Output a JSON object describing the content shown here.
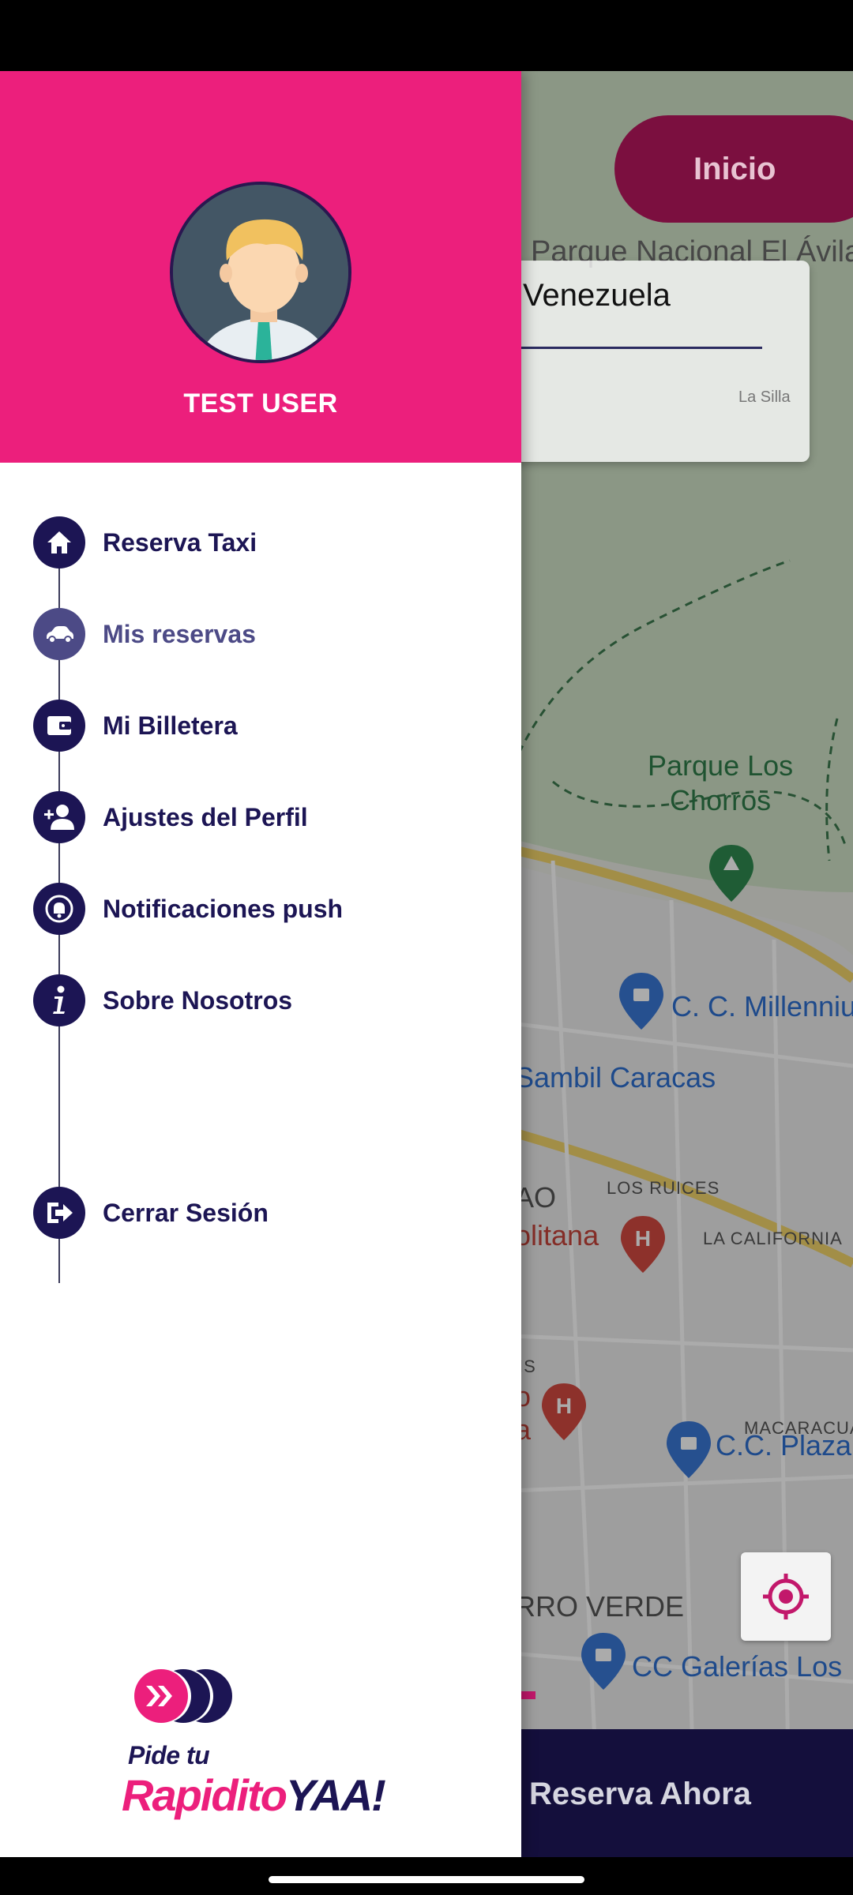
{
  "user": {
    "name": "TEST USER"
  },
  "menu": {
    "items": [
      {
        "label": "Reserva Taxi",
        "icon": "home-icon",
        "active": false
      },
      {
        "label": "Mis reservas",
        "icon": "car-icon",
        "active": true
      },
      {
        "label": "Mi Billetera",
        "icon": "wallet-icon",
        "active": false
      },
      {
        "label": "Ajustes del Perfil",
        "icon": "add-user-icon",
        "active": false
      },
      {
        "label": "Notificaciones push",
        "icon": "bell-icon",
        "active": false
      },
      {
        "label": "Sobre Nosotros",
        "icon": "info-icon",
        "active": false
      }
    ],
    "logout": {
      "label": "Cerrar Sesión",
      "icon": "logout-icon"
    }
  },
  "logo": {
    "line1": "Pide tu",
    "line2_pink": "Rapidito",
    "line2_navy": "YAA!"
  },
  "map": {
    "inicio_label": "Inicio",
    "search_value": "Venezuela",
    "labels": {
      "park_avila": "Parque Nacional El Ávila",
      "park_chorros": "Parque Los\nChorros",
      "cc_millennium": "C. C. Millenniu",
      "sambil": "Sambil Caracas",
      "los_ruices": "LOS RUICES",
      "ao": "AO",
      "politana": "olitana",
      "la_california": "LA CALIFORNIA",
      "macaracuay": "MACARACUA",
      "cc_plaza": "C.C. Plaza",
      "cerro_verde": "RRO VERDE",
      "cc_galerias": "CC Galerías Los",
      "is": "IS",
      "o": "o",
      "a": "a",
      "small_hint": "La Silla"
    }
  },
  "bottom_bar": {
    "label": "Reserva Ahora"
  },
  "colors": {
    "brand_pink": "#ec1f7c",
    "brand_navy": "#1c1554",
    "inicio_bg": "#7b0f3f"
  }
}
